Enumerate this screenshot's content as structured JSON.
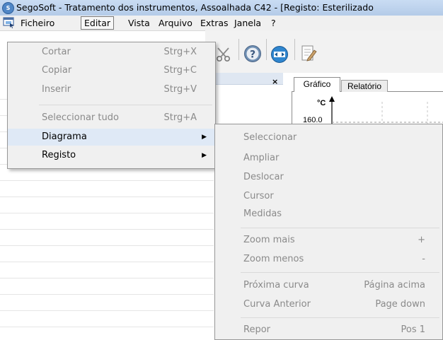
{
  "window": {
    "title": "SegoSoft - Tratamento dos instrumentos, Assoalhada C42 - [Registo: Esterilizado",
    "app_icon_text": "S"
  },
  "menubar": {
    "items": [
      "Ficheiro",
      "Editar",
      "Vista",
      "Arquivo",
      "Extras",
      "Janela",
      "?"
    ]
  },
  "panel": {
    "close_symbol": "×"
  },
  "tabs": {
    "grafico": "Gráfico",
    "relatorio": "Relatório"
  },
  "chart": {
    "unit": "°C",
    "top_tick": "160.0"
  },
  "edit_menu": {
    "items": [
      {
        "label": "Cortar",
        "shortcut": "Strg+X"
      },
      {
        "label": "Copiar",
        "shortcut": "Strg+C"
      },
      {
        "label": "Inserir",
        "shortcut": "Strg+V"
      },
      {
        "label": "Seleccionar tudo",
        "shortcut": "Strg+A"
      },
      {
        "label": "Diagrama",
        "shortcut": ""
      },
      {
        "label": "Registo",
        "shortcut": ""
      }
    ]
  },
  "diagram_menu": {
    "items": [
      {
        "label": "Seleccionar",
        "shortcut": ""
      },
      {
        "label": "Ampliar",
        "shortcut": ""
      },
      {
        "label": "Deslocar",
        "shortcut": ""
      },
      {
        "label": "Cursor",
        "shortcut": ""
      },
      {
        "label": "Medidas",
        "shortcut": ""
      },
      {
        "label": "Zoom mais",
        "shortcut": "+"
      },
      {
        "label": "Zoom menos",
        "shortcut": "-"
      },
      {
        "label": "Próxima curva",
        "shortcut": "Página acima"
      },
      {
        "label": "Curva Anterior",
        "shortcut": "Page down"
      },
      {
        "label": "Repor",
        "shortcut": "Pos 1"
      }
    ]
  }
}
